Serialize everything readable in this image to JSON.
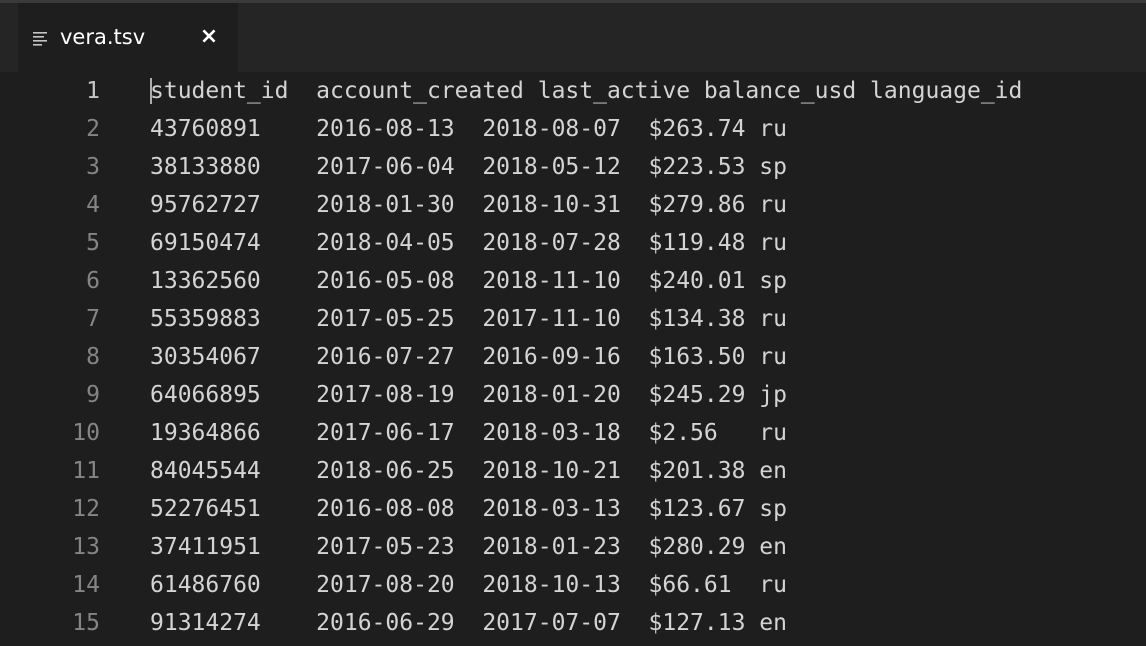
{
  "tab": {
    "icon": "lines-file-icon",
    "title": "vera.tsv",
    "close_label": "×"
  },
  "editor": {
    "lines": [
      {
        "number": "1",
        "text": "student_id  account_created last_active balance_usd language_id"
      },
      {
        "number": "2",
        "text": "43760891    2016-08-13  2018-08-07  $263.74 ru"
      },
      {
        "number": "3",
        "text": "38133880    2017-06-04  2018-05-12  $223.53 sp"
      },
      {
        "number": "4",
        "text": "95762727    2018-01-30  2018-10-31  $279.86 ru"
      },
      {
        "number": "5",
        "text": "69150474    2018-04-05  2018-07-28  $119.48 ru"
      },
      {
        "number": "6",
        "text": "13362560    2016-05-08  2018-11-10  $240.01 sp"
      },
      {
        "number": "7",
        "text": "55359883    2017-05-25  2017-11-10  $134.38 ru"
      },
      {
        "number": "8",
        "text": "30354067    2016-07-27  2016-09-16  $163.50 ru"
      },
      {
        "number": "9",
        "text": "64066895    2017-08-19  2018-01-20  $245.29 jp"
      },
      {
        "number": "10",
        "text": "19364866    2017-06-17  2018-03-18  $2.56   ru"
      },
      {
        "number": "11",
        "text": "84045544    2018-06-25  2018-10-21  $201.38 en"
      },
      {
        "number": "12",
        "text": "52276451    2016-08-08  2018-03-13  $123.67 sp"
      },
      {
        "number": "13",
        "text": "37411951    2017-05-23  2018-01-23  $280.29 en"
      },
      {
        "number": "14",
        "text": "61486760    2017-08-20  2018-10-13  $66.61  ru"
      },
      {
        "number": "15",
        "text": "91314274    2016-06-29  2017-07-07  $127.13 en"
      }
    ]
  }
}
